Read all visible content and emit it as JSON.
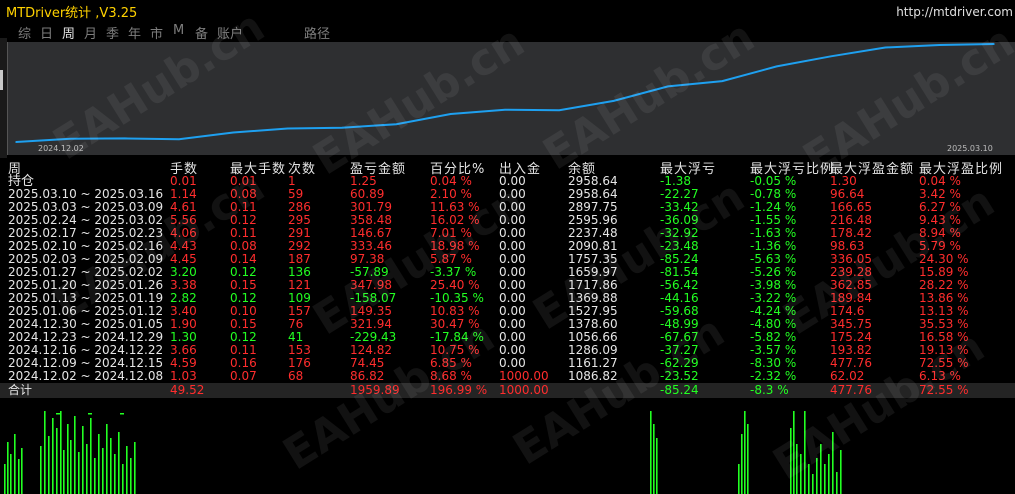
{
  "app": {
    "title": "MTDriver统计 ,V3.25",
    "url": "http://mtdriver.com"
  },
  "tabs": [
    {
      "label": "综",
      "active": false
    },
    {
      "label": "日",
      "active": false
    },
    {
      "label": "周",
      "active": true
    },
    {
      "label": "月",
      "active": false
    },
    {
      "label": "季",
      "active": false
    },
    {
      "label": "年",
      "active": false
    },
    {
      "label": "市",
      "active": false
    },
    {
      "label": "M",
      "active": false
    },
    {
      "label": "备",
      "active": false
    },
    {
      "label": "账户",
      "active": false
    },
    {
      "label": "路径",
      "active": false
    }
  ],
  "chart_data": {
    "type": "line",
    "x_start_label": "2024.12.02",
    "x_end_label": "2025.03.10",
    "y": [
      1000,
      1066.66,
      1076.51,
      1057.55,
      1201.16,
      1284.77,
      1303.01,
      1377.14,
      1592.52,
      1683.88,
      1672.47,
      1869.71,
      2175.48,
      2288.76,
      2599.56,
      2812.32,
      2998.45,
      3052.1,
      3072.34
    ],
    "line_color": "#1ea0f0",
    "background": "#2e2f31"
  },
  "colors": {
    "red": "#ff2d2d",
    "green": "#22ff22",
    "white": "#e6e6e6",
    "title": "#ffd200"
  },
  "table": {
    "headers": [
      "周",
      "手数",
      "最大手数",
      "次数",
      "盈亏金额",
      "百分比%",
      "出入金",
      "余额",
      "最大浮亏",
      "最大浮亏比例",
      "最大浮盈金额",
      "最大浮盈比例"
    ],
    "rows": [
      {
        "period": "持仓",
        "lots": "0.01",
        "maxlots": "0.01",
        "count": "1",
        "pnl": "1.25",
        "pct": "0.04 %",
        "dep": "0.00",
        "bal": "2958.64",
        "maxdd": "-1.38",
        "ddpct": "-0.05 %",
        "maxfp": "1.30",
        "fppct": "0.04 %",
        "c": [
          "red",
          "red",
          "red",
          "red",
          "red",
          "white",
          "white",
          "green",
          "green",
          "red",
          "red"
        ]
      },
      {
        "period": "2025.03.10 ~ 2025.03.16",
        "lots": "1.14",
        "maxlots": "0.08",
        "count": "59",
        "pnl": "60.89",
        "pct": "2.10 %",
        "dep": "0.00",
        "bal": "2958.64",
        "maxdd": "-22.27",
        "ddpct": "-0.78 %",
        "maxfp": "96.64",
        "fppct": "3.42 %",
        "c": [
          "red",
          "red",
          "red",
          "red",
          "red",
          "white",
          "white",
          "green",
          "green",
          "red",
          "red"
        ]
      },
      {
        "period": "2025.03.03 ~ 2025.03.09",
        "lots": "4.61",
        "maxlots": "0.11",
        "count": "286",
        "pnl": "301.79",
        "pct": "11.63 %",
        "dep": "0.00",
        "bal": "2897.75",
        "maxdd": "-33.42",
        "ddpct": "-1.24 %",
        "maxfp": "166.65",
        "fppct": "6.27 %",
        "c": [
          "red",
          "red",
          "red",
          "red",
          "red",
          "white",
          "white",
          "green",
          "green",
          "red",
          "red"
        ]
      },
      {
        "period": "2025.02.24 ~ 2025.03.02",
        "lots": "5.56",
        "maxlots": "0.12",
        "count": "295",
        "pnl": "358.48",
        "pct": "16.02 %",
        "dep": "0.00",
        "bal": "2595.96",
        "maxdd": "-36.09",
        "ddpct": "-1.55 %",
        "maxfp": "216.48",
        "fppct": "9.43 %",
        "c": [
          "red",
          "red",
          "red",
          "red",
          "red",
          "white",
          "white",
          "green",
          "green",
          "red",
          "red"
        ]
      },
      {
        "period": "2025.02.17 ~ 2025.02.23",
        "lots": "4.06",
        "maxlots": "0.11",
        "count": "291",
        "pnl": "146.67",
        "pct": "7.01 %",
        "dep": "0.00",
        "bal": "2237.48",
        "maxdd": "-32.92",
        "ddpct": "-1.63 %",
        "maxfp": "178.42",
        "fppct": "8.94 %",
        "c": [
          "red",
          "red",
          "red",
          "red",
          "red",
          "white",
          "white",
          "green",
          "green",
          "red",
          "red"
        ]
      },
      {
        "period": "2025.02.10 ~ 2025.02.16",
        "lots": "4.43",
        "maxlots": "0.08",
        "count": "292",
        "pnl": "333.46",
        "pct": "18.98 %",
        "dep": "0.00",
        "bal": "2090.81",
        "maxdd": "-23.48",
        "ddpct": "-1.36 %",
        "maxfp": "98.63",
        "fppct": "5.79 %",
        "c": [
          "red",
          "red",
          "red",
          "red",
          "red",
          "white",
          "white",
          "green",
          "green",
          "red",
          "red"
        ]
      },
      {
        "period": "2025.02.03 ~ 2025.02.09",
        "lots": "4.45",
        "maxlots": "0.14",
        "count": "187",
        "pnl": "97.38",
        "pct": "5.87 %",
        "dep": "0.00",
        "bal": "1757.35",
        "maxdd": "-85.24",
        "ddpct": "-5.63 %",
        "maxfp": "336.05",
        "fppct": "24.30 %",
        "c": [
          "red",
          "red",
          "red",
          "red",
          "red",
          "white",
          "white",
          "green",
          "green",
          "red",
          "red"
        ]
      },
      {
        "period": "2025.01.27 ~ 2025.02.02",
        "lots": "3.20",
        "maxlots": "0.12",
        "count": "136",
        "pnl": "-57.89",
        "pct": "-3.37 %",
        "dep": "0.00",
        "bal": "1659.97",
        "maxdd": "-81.54",
        "ddpct": "-5.26 %",
        "maxfp": "239.28",
        "fppct": "15.89 %",
        "c": [
          "green",
          "green",
          "green",
          "green",
          "green",
          "white",
          "white",
          "green",
          "green",
          "red",
          "red"
        ]
      },
      {
        "period": "2025.01.20 ~ 2025.01.26",
        "lots": "3.38",
        "maxlots": "0.15",
        "count": "121",
        "pnl": "347.98",
        "pct": "25.40 %",
        "dep": "0.00",
        "bal": "1717.86",
        "maxdd": "-56.42",
        "ddpct": "-3.98 %",
        "maxfp": "362.85",
        "fppct": "28.22 %",
        "c": [
          "red",
          "red",
          "red",
          "red",
          "red",
          "white",
          "white",
          "green",
          "green",
          "red",
          "red"
        ]
      },
      {
        "period": "2025.01.13 ~ 2025.01.19",
        "lots": "2.82",
        "maxlots": "0.12",
        "count": "109",
        "pnl": "-158.07",
        "pct": "-10.35 %",
        "dep": "0.00",
        "bal": "1369.88",
        "maxdd": "-44.16",
        "ddpct": "-3.22 %",
        "maxfp": "189.84",
        "fppct": "13.86 %",
        "c": [
          "green",
          "green",
          "green",
          "green",
          "green",
          "white",
          "white",
          "green",
          "green",
          "red",
          "red"
        ]
      },
      {
        "period": "2025.01.06 ~ 2025.01.12",
        "lots": "3.40",
        "maxlots": "0.10",
        "count": "157",
        "pnl": "149.35",
        "pct": "10.83 %",
        "dep": "0.00",
        "bal": "1527.95",
        "maxdd": "-59.68",
        "ddpct": "-4.24 %",
        "maxfp": "174.6",
        "fppct": "13.13 %",
        "c": [
          "red",
          "red",
          "red",
          "red",
          "red",
          "white",
          "white",
          "green",
          "green",
          "red",
          "red"
        ]
      },
      {
        "period": "2024.12.30 ~ 2025.01.05",
        "lots": "1.90",
        "maxlots": "0.15",
        "count": "76",
        "pnl": "321.94",
        "pct": "30.47 %",
        "dep": "0.00",
        "bal": "1378.60",
        "maxdd": "-48.99",
        "ddpct": "-4.80 %",
        "maxfp": "345.75",
        "fppct": "35.53 %",
        "c": [
          "red",
          "red",
          "red",
          "red",
          "red",
          "white",
          "white",
          "green",
          "green",
          "red",
          "red"
        ]
      },
      {
        "period": "2024.12.23 ~ 2024.12.29",
        "lots": "1.30",
        "maxlots": "0.12",
        "count": "41",
        "pnl": "-229.43",
        "pct": "-17.84 %",
        "dep": "0.00",
        "bal": "1056.66",
        "maxdd": "-67.67",
        "ddpct": "-5.82 %",
        "maxfp": "175.24",
        "fppct": "16.58 %",
        "c": [
          "green",
          "green",
          "green",
          "green",
          "green",
          "white",
          "white",
          "green",
          "green",
          "red",
          "red"
        ]
      },
      {
        "period": "2024.12.16 ~ 2024.12.22",
        "lots": "3.66",
        "maxlots": "0.11",
        "count": "153",
        "pnl": "124.82",
        "pct": "10.75 %",
        "dep": "0.00",
        "bal": "1286.09",
        "maxdd": "-37.27",
        "ddpct": "-3.57 %",
        "maxfp": "193.82",
        "fppct": "19.13 %",
        "c": [
          "red",
          "red",
          "red",
          "red",
          "red",
          "white",
          "white",
          "green",
          "green",
          "red",
          "red"
        ]
      },
      {
        "period": "2024.12.09 ~ 2024.12.15",
        "lots": "4.59",
        "maxlots": "0.16",
        "count": "176",
        "pnl": "74.45",
        "pct": "6.85 %",
        "dep": "0.00",
        "bal": "1161.27",
        "maxdd": "-62.29",
        "ddpct": "-8.30 %",
        "maxfp": "477.76",
        "fppct": "72.55 %",
        "c": [
          "red",
          "red",
          "red",
          "red",
          "red",
          "white",
          "white",
          "green",
          "green",
          "red",
          "red"
        ]
      },
      {
        "period": "2024.12.02 ~ 2024.12.08",
        "lots": "1.03",
        "maxlots": "0.07",
        "count": "68",
        "pnl": "86.82",
        "pct": "8.68 %",
        "dep": "1000.00",
        "bal": "1086.82",
        "maxdd": "-23.52",
        "ddpct": "-2.32 %",
        "maxfp": "62.02",
        "fppct": "6.13 %",
        "c": [
          "red",
          "red",
          "red",
          "red",
          "red",
          "red",
          "white",
          "green",
          "green",
          "red",
          "red"
        ]
      }
    ],
    "total": {
      "period": "合计",
      "lots": "49.52",
      "maxlots": "",
      "count": "",
      "pnl": "1959.89",
      "pct": "196.99 %",
      "dep": "1000.00",
      "bal": "",
      "maxdd": "-85.24",
      "ddpct": "-8.3 %",
      "maxfp": "477.76",
      "fppct": "72.55 %",
      "c": [
        "red",
        "red",
        "red",
        "red",
        "red",
        "red",
        "white",
        "green",
        "green",
        "red",
        "red"
      ]
    }
  },
  "watermark": "EAHub.cn",
  "background_bars": {
    "color": "#22ff22"
  }
}
